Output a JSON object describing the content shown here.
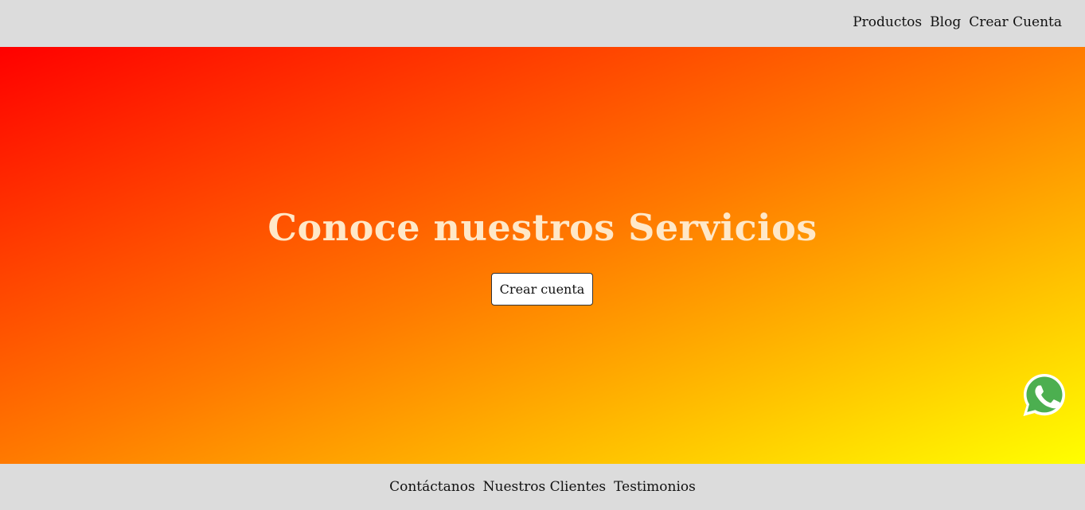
{
  "header": {
    "nav": [
      "Productos",
      "Blog",
      "Crear Cuenta"
    ]
  },
  "hero": {
    "title": "Conoce nuestros Servicios",
    "cta_label": "Crear cuenta",
    "gradient_colors": [
      "#ff0000",
      "#ff7a00",
      "#ffff00"
    ]
  },
  "floating": {
    "whatsapp_icon": "whatsapp-icon",
    "whatsapp_color": "#4caf50"
  },
  "footer": {
    "nav": [
      "Contáctanos",
      "Nuestros Clientes",
      "Testimonios"
    ]
  }
}
